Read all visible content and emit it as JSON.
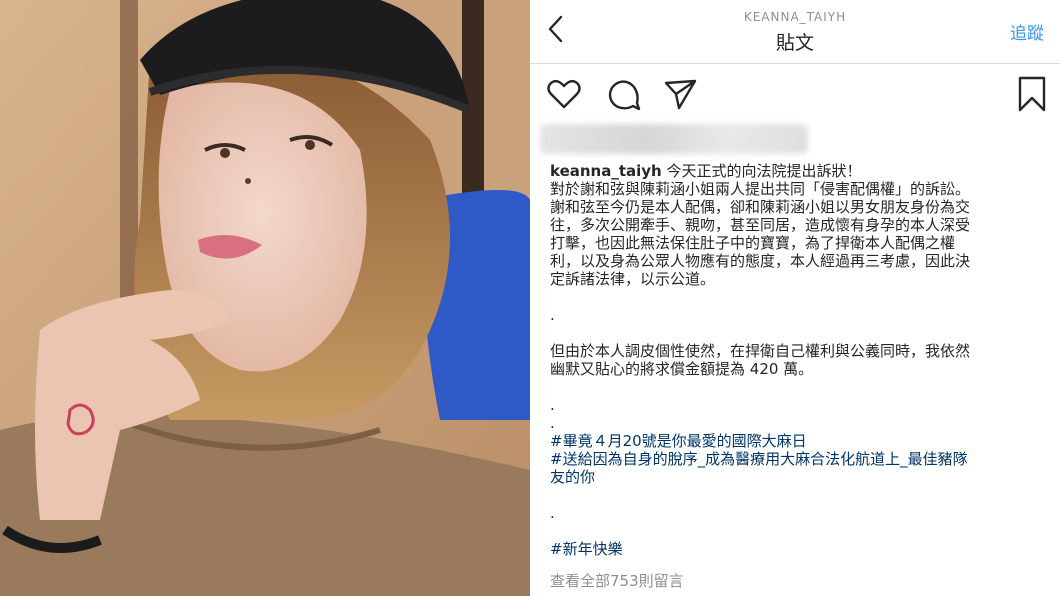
{
  "header": {
    "username": "KEANNA_TAIYH",
    "title": "貼文",
    "follow_label": "追蹤"
  },
  "icons": [
    "heart-icon",
    "comment-icon",
    "share-icon",
    "bookmark-icon",
    "back-chevron-icon"
  ],
  "caption": {
    "username": "keanna_taiyh",
    "first_line": "今天正式的向法院提出訴狀！",
    "para1": [
      "對於謝和弦與陳莉涵小姐兩人提出共同「侵害配偶權」的訴訟。",
      "謝和弦至今仍是本人配偶，卻和陳莉涵小姐以男女朋友身份為交",
      "往，多次公開牽手、親吻，甚至同居，造成懷有身孕的本人深受",
      "打擊，也因此無法保住肚子中的寶寶，為了捍衛本人配偶之權",
      "利，以及身為公眾人物應有的態度，本人經過再三考慮，因此決",
      "定訴諸法律，以示公道。"
    ],
    "dot": ".",
    "para2": [
      "但由於本人調皮個性使然，在捍衛自己權利與公義同時，我依然",
      "幽默又貼心的將求償金額提為 420 萬。"
    ],
    "hashtag1": "#畢竟４月20號是你最愛的國際大麻日",
    "hashtag2": [
      "#送給因為自身的脫序_成為醫療用大麻合法化航道上_最佳豬隊",
      "友的你"
    ],
    "hashtag3": "#新年快樂"
  },
  "comments_link": "查看全部753則留言",
  "colors": {
    "link": "#3897f0",
    "hashtag": "#003569",
    "muted": "#8e8e8e",
    "text": "#262626"
  }
}
